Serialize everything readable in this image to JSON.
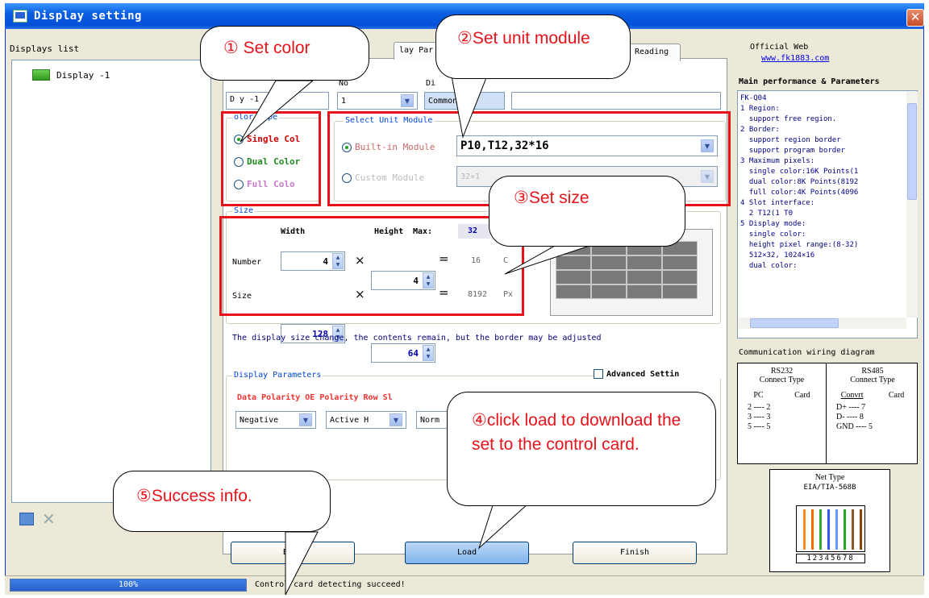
{
  "window": {
    "title": "Display setting",
    "close_glyph": "✕"
  },
  "displays_list": {
    "label": "Displays list",
    "items": [
      {
        "label": "Display -1"
      }
    ]
  },
  "tabs": {
    "display_params": "lay Par",
    "reading": "Reading"
  },
  "name_field": {
    "value": "D  y -1"
  },
  "no_combo": {
    "label": "No",
    "value": "1"
  },
  "type_combo": {
    "label": "Di",
    "value": "Common"
  },
  "color_type": {
    "title": "olor Type",
    "options": [
      {
        "label": "Single Col",
        "color": "#cc0000",
        "selected": true
      },
      {
        "label": "Dual Color",
        "color": "#1f8a1f",
        "selected": false
      },
      {
        "label": "Full Colo",
        "color": "#c878c8",
        "selected": false
      }
    ]
  },
  "unit_module": {
    "title": "Select Unit Module",
    "builtin_label": "Built-in Module",
    "builtin_value": "P10,T12,32*16",
    "custom_label": "Custom Module",
    "custom_value": "32×1"
  },
  "size": {
    "title": "Size",
    "col_width": "Width",
    "col_height": "Height",
    "col_max": "Max:",
    "max_value": "32",
    "number_label": "Number",
    "number_width": "4",
    "number_height": "4",
    "number_result": "16",
    "number_unit": "C",
    "size_label": "Size",
    "size_width": "128",
    "size_height": "64",
    "size_result": "8192",
    "size_unit": "Px",
    "times": "×",
    "equals": "="
  },
  "note": "The display size change, the contents remain, but the border may be adjusted",
  "display_params": {
    "title": "Display Parameters",
    "advanced": "Advanced Settin",
    "headers": "Data Polarity OE Polarity Row Sl",
    "data_polarity": "Negative",
    "oe_polarity": "Active H",
    "row_sl": "Norm"
  },
  "buttons": {
    "back": "Back",
    "load": "Load",
    "finish": "Finish"
  },
  "official_web": {
    "label": "Official Web",
    "url": "www.fk1883.com"
  },
  "main_perf": {
    "title": "Main performance & Parameters",
    "text": "FK-Q04\n1 Region:\n  support free region.\n2 Border:\n  support region border\n  support program border\n3 Maximum pixels:\n  single color:16K Points(1\n  dual color:8K Points(8192\n  full color:4K Points(4096\n4 Slot interface:\n  2 T12(1 T0\n5 Display mode:\n  single color:\n  height pixel range:(8-32)\n  512×32, 1024×16\n  dual color:"
  },
  "wiring": {
    "title": "Communication wiring diagram",
    "rs232": "RS232\nConnect Type",
    "rs485": "RS485\nConnect Type",
    "pc": "PC",
    "card": "Card",
    "convert": "Convrt",
    "card2": "Card",
    "rows232": [
      "2 ---- 2",
      "3 ---- 3",
      "5 ---- 5"
    ],
    "rows485": [
      "D+ ---- 7",
      "D- ---- 8",
      "GND ---- 5"
    ]
  },
  "net_type": {
    "title": "Net Type",
    "standard": "EIA/TIA-568B",
    "pins": "12345678",
    "wire_colors": [
      "#f28c28",
      "#ff6600",
      "#33aa33",
      "#3355ff",
      "#6699ff",
      "#22aa22",
      "#8b5a2b",
      "#884400"
    ]
  },
  "status": {
    "progress": "100%",
    "progress_value": 1.0,
    "message": "Control card detecting succeed!"
  },
  "callouts": {
    "c1": "① Set color",
    "c2": "②Set unit module",
    "c3": "③Set size",
    "c4": "④click load to download the set to the control card.",
    "c5": "⑤Success info."
  },
  "colors": {
    "accent_red": "#e8121a",
    "title_blue": "#0a5ee0"
  }
}
